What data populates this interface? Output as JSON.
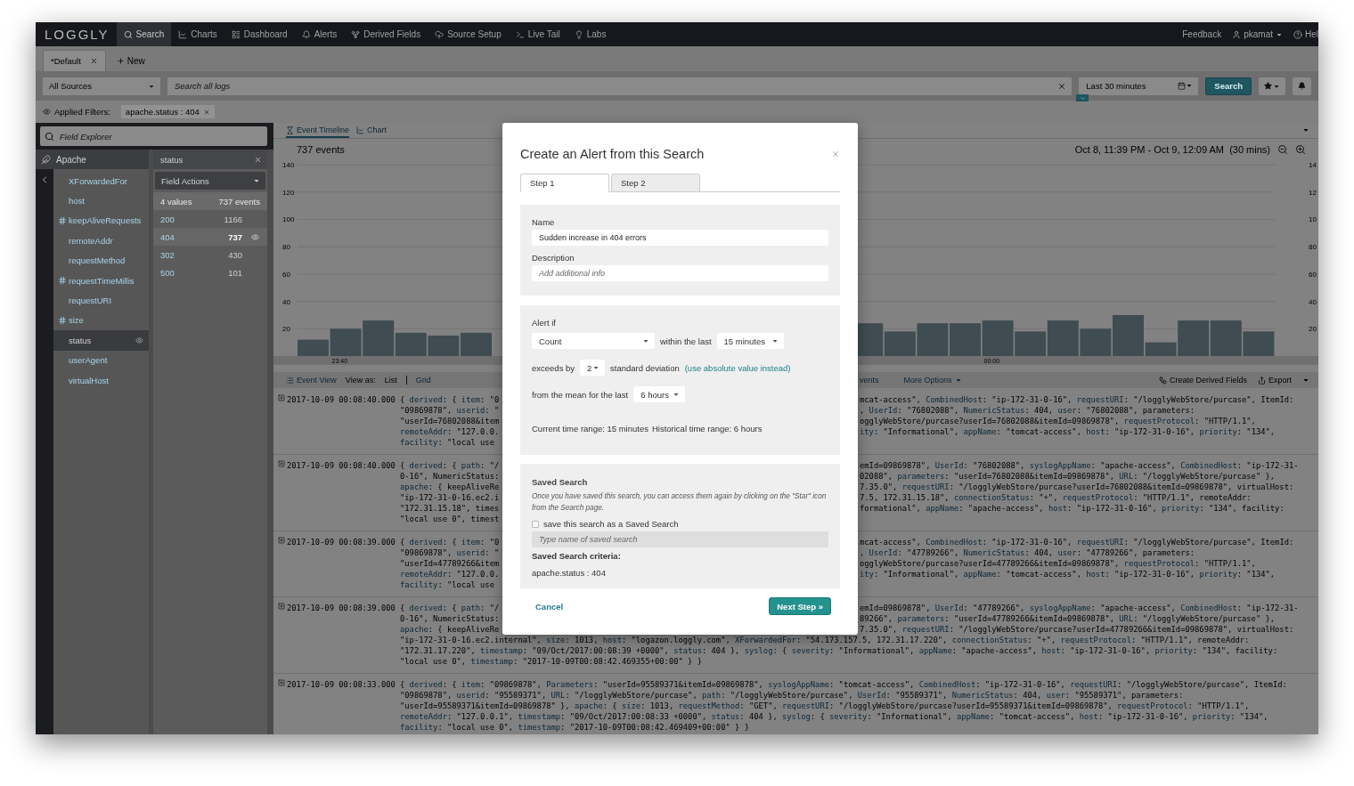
{
  "nav": {
    "logo": "LOGGLY",
    "items": [
      {
        "label": "Search",
        "selected": true
      },
      {
        "label": "Charts",
        "selected": false
      },
      {
        "label": "Dashboard",
        "selected": false
      },
      {
        "label": "Alerts",
        "selected": false
      },
      {
        "label": "Derived Fields",
        "selected": false
      },
      {
        "label": "Source Setup",
        "selected": false
      },
      {
        "label": "Live Tail",
        "selected": false
      },
      {
        "label": "Labs",
        "selected": false
      }
    ],
    "feedback": "Feedback",
    "user": "pkamat",
    "help": "Hel"
  },
  "tabs": [
    {
      "label": "*Default",
      "selected": true
    }
  ],
  "new_tab": "New",
  "search_bar": {
    "source": "All Sources",
    "placeholder": "Search all logs",
    "time_range": "Last 30 minutes",
    "button": "Search"
  },
  "filters": {
    "label": "Applied Filters:",
    "chips": [
      "apache.status : 404"
    ]
  },
  "field_explorer": {
    "placeholder": "Field Explorer",
    "group": "Apache",
    "fields": [
      {
        "name": "XForwardedFor",
        "kind": "text",
        "selected": false
      },
      {
        "name": "host",
        "kind": "text",
        "selected": false
      },
      {
        "name": "keepAliveRequests",
        "kind": "number",
        "selected": false
      },
      {
        "name": "remoteAddr",
        "kind": "text",
        "selected": false
      },
      {
        "name": "requestMethod",
        "kind": "text",
        "selected": false
      },
      {
        "name": "requestTimeMillis",
        "kind": "number",
        "selected": false
      },
      {
        "name": "requestURI",
        "kind": "text",
        "selected": false
      },
      {
        "name": "size",
        "kind": "number",
        "selected": false
      },
      {
        "name": "status",
        "kind": "text",
        "selected": true
      },
      {
        "name": "userAgent",
        "kind": "text",
        "selected": false
      },
      {
        "name": "virtualHost",
        "kind": "text",
        "selected": false
      }
    ]
  },
  "field_panel": {
    "title": "status",
    "actions": "Field Actions",
    "summary_values": "4 values",
    "summary_events": "737 events",
    "rows": [
      {
        "value": "200",
        "count": "1166",
        "selected": false
      },
      {
        "value": "404",
        "count": "737",
        "selected": true
      },
      {
        "value": "302",
        "count": "430",
        "selected": false
      },
      {
        "value": "500",
        "count": "101",
        "selected": false
      }
    ]
  },
  "view_tabs": [
    {
      "label": "Event Timeline",
      "selected": true
    },
    {
      "label": "Chart",
      "selected": false
    }
  ],
  "timeline": {
    "count": "737 events",
    "range": "Oct 8, 11:39 PM - Oct 9, 12:09 AM  (30 mins)",
    "right_ticks": [
      "14",
      "12",
      "10",
      "80",
      "60",
      "40",
      "20"
    ],
    "x_labels": [
      "23:40",
      "00:00"
    ],
    "chart_data": {
      "type": "bar",
      "grid": true,
      "ylim": [
        0,
        140
      ],
      "yticks": [
        140,
        120,
        100,
        80,
        60,
        40,
        20
      ],
      "values": [
        12,
        20,
        26,
        17,
        15,
        17,
        null,
        null,
        null,
        null,
        null,
        null,
        null,
        null,
        null,
        null,
        null,
        24,
        18,
        24,
        24,
        26,
        18,
        26,
        20,
        30,
        10,
        26,
        26,
        18
      ]
    }
  },
  "event_toolbar": {
    "view": "Event View",
    "view_as": "View as:",
    "options": [
      {
        "label": "List",
        "selected": true
      },
      {
        "label": "Grid",
        "selected": false
      }
    ],
    "events_fragment": "vents",
    "more": "More Options",
    "derived": "Create Derived Fields",
    "export": "Export"
  },
  "events": [
    {
      "timestamp": "2017-10-09 00:08:40.000",
      "lines": [
        {
          "left": "{ derived: { item: \"0",
          "right": "mcat-access\", CombinedHost: \"ip-172-31-0-16\", requestURI: \"/logglyWebStore/purcase\", ItemId:"
        },
        {
          "left": "\"09869878\", userid: \"",
          "right": ", UserId: \"76802088\", NumericStatus: 404, user: \"76802088\", parameters:"
        },
        {
          "left": "\"userId=76802088&item",
          "right": "ogglyWebStore/purcase?userId=76802088&itemId=09869878\", requestProtocol: \"HTTP/1.1\","
        },
        {
          "left": "remoteAddr: \"127.0.0.",
          "right": "ity: \"Informational\", appName: \"tomcat-access\", host: \"ip-172-31-0-16\", priority: \"134\","
        },
        {
          "left": "facility: \"local use"
        }
      ]
    },
    {
      "timestamp": "2017-10-09 00:08:40.000",
      "lines": [
        {
          "left": "{ derived: { path: \"/",
          "right": "emId=09869878\", UserId: \"76802088\", syslogAppName: \"apache-access\", CombinedHost: \"ip-172-31-"
        },
        {
          "left": "0-16\", NumericStatus:",
          "right": "02088\", parameters: \"userId=76802088&itemId=09869878\", URL: \"/logglyWebStore/purcase\" },"
        },
        {
          "left": "apache: { keepAliveRe",
          "right": "7.35.0\", requestURI: \"/logglyWebStore/purcase?userId=76802088&itemId=09869878\", virtualHost:"
        },
        {
          "left": "\"ip-172-31-0-16.ec2.i",
          "right": "7.5, 172.31.15.18\", connectionStatus: \"+\", requestProtocol: \"HTTP/1.1\", remoteAddr:"
        },
        {
          "left": "\"172.31.15.18\", times",
          "right": "formational\", appName: \"apache-access\", host: \"ip-172-31-0-16\", priority: \"134\", facility:"
        },
        {
          "left": "\"local use 0\", timest"
        }
      ]
    },
    {
      "timestamp": "2017-10-09 00:08:39.000",
      "lines": [
        {
          "left": "{ derived: { item: \"0",
          "right": "mcat-access\", CombinedHost: \"ip-172-31-0-16\", requestURI: \"/logglyWebStore/purcase\", ItemId:"
        },
        {
          "left": "\"09869878\", userid: \"",
          "right": ", UserId: \"47789266\", NumericStatus: 404, user: \"47789266\", parameters:"
        },
        {
          "left": "\"userId=47789266&item",
          "right": "ogglyWebStore/purcase?userId=47789266&itemId=09869878\", requestProtocol: \"HTTP/1.1\","
        },
        {
          "left": "remoteAddr: \"127.0.0.",
          "right": "ity: \"Informational\", appName: \"tomcat-access\", host: \"ip-172-31-0-16\", priority: \"134\","
        },
        {
          "left": "facility: \"local use"
        }
      ]
    },
    {
      "timestamp": "2017-10-09 00:08:39.000",
      "lines": [
        {
          "left": "{ derived: { path: \"/",
          "right": "emId=09869878\", UserId: \"47789266\", syslogAppName: \"apache-access\", CombinedHost: \"ip-172-31-"
        },
        {
          "left": "0-16\", NumericStatus:",
          "right": "89266\", parameters: \"userId=47789266&itemId=09869878\", URL: \"/logglyWebStore/purcase\" },"
        },
        {
          "left": "apache: { keepAliveRe",
          "right": "7.35.0\", requestURI: \"/logglyWebStore/purcase?userId=47789266&itemId=09869878\", virtualHost:"
        },
        {
          "text": "\"ip-172-31-0-16.ec2.internal\", size: 1013, host: \"logazon.loggly.com\", XForwardedFor: \"54.173.157.5, 172.31.17.220\", connectionStatus: \"+\", requestProtocol: \"HTTP/1.1\", remoteAddr:"
        },
        {
          "text": "\"172.31.17.220\", timestamp: \"09/Oct/2017:00:08:39 +0000\", status: 404 }, syslog: { severity: \"Informational\", appName: \"apache-access\", host: \"ip-172-31-0-16\", priority: \"134\", facility:"
        },
        {
          "text": "\"local use 0\", timestamp: \"2017-10-09T00:08:42.469355+00:00\" } }"
        }
      ]
    },
    {
      "timestamp": "2017-10-09 00:08:33.000",
      "lines": [
        {
          "text": "{ derived: { item: \"09869878\", Parameters: \"userId=95589371&itemId=09869878\", syslogAppName: \"tomcat-access\", CombinedHost: \"ip-172-31-0-16\", requestURI: \"/logglyWebStore/purcase\", ItemId:"
        },
        {
          "text": "\"09869878\", userid: \"95589371\", URL: \"/logglyWebStore/purcase\", path: \"/logglyWebStore/purcase\", UserId: \"95589371\", NumericStatus: 404, user: \"95589371\", parameters:"
        },
        {
          "text": "\"userId=95589371&itemId=09869878\" }, apache: { size: 1013, requestMethod: \"GET\", requestURI: \"/logglyWebStore/purcase?userId=95589371&itemId=09869878\", requestProtocol: \"HTTP/1.1\","
        },
        {
          "text": "remoteAddr: \"127.0.0.1\", timestamp: \"09/Oct/2017:00:08:33 +0000\", status: 404 }, syslog: { severity: \"Informational\", appName: \"tomcat-access\", host: \"ip-172-31-0-16\", priority: \"134\","
        },
        {
          "text": "facility: \"local use 0\", timestamp: \"2017-10-09T00:08:42.469409+00:00\" } }"
        }
      ]
    }
  ],
  "modal": {
    "title": "Create an Alert from this Search",
    "tabs": [
      {
        "label": "Step 1",
        "selected": true
      },
      {
        "label": "Step 2",
        "selected": false
      }
    ],
    "name_label": "Name",
    "name_value": "Sudden increase in 404 errors",
    "description_label": "Description",
    "description_placeholder": "Add additional info",
    "alert": {
      "label": "Alert if",
      "metric": "Count",
      "within": "within the last",
      "window": "15 minutes",
      "exceeds": "exceeds by",
      "deviations": "2",
      "std": "standard deviation",
      "link": "(use absolute value instead)",
      "mean": "from the mean for the last",
      "history": "6 hours",
      "current_range": "Current time range: 15 minutes",
      "historical_range": "Historical time range: 6 hours"
    },
    "saved": {
      "title": "Saved Search",
      "help": "Once you have saved this search, you can access them again by clicking on the \"Star\" icon from the Search page.",
      "checkbox_label": "save this search as a Saved Search",
      "checked": false,
      "placeholder": "Type name of saved search",
      "criteria_label": "Saved Search criteria:",
      "criteria": "apache.status : 404"
    },
    "cancel": "Cancel",
    "next": "Next Step »"
  }
}
